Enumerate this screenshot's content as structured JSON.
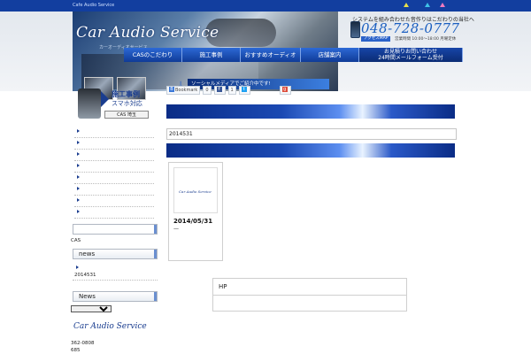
{
  "topbar": {
    "text": "Cafe Audio Service",
    "triangles": [
      "#e8e04a",
      "#3fc2e8",
      "#f07ac0"
    ]
  },
  "header": {
    "logo": "Car Audio Service",
    "logo_sub": "カーオーディオサービス",
    "tagline": "システムを組み合わせた音作りはこだわりの当社へ",
    "tel": "048-728-0777",
    "access": "アクセスMAP",
    "hours": "営業時間 10:00～18:00 月曜定休",
    "sns_banner": "ソーシャルメディアでご紹介中です!"
  },
  "nav": [
    {
      "label": "CASのこだわり"
    },
    {
      "label": "施工事例"
    },
    {
      "label": "おすすめオーディオ"
    },
    {
      "label": "店舗案内"
    },
    {
      "label": "お見積りお問い合わせ",
      "sub": "24時間メールフォーム受付"
    }
  ],
  "promo": {
    "title": "施工事例",
    "subtitle": "スマホ対応",
    "button": "CAS 埼玉"
  },
  "share": {
    "bookmark": "Bookmark",
    "count1": "0",
    "count2": "1"
  },
  "main": {
    "breadcrumb": "2014531",
    "post_date": "2014/05/31",
    "post_excerpt": "—",
    "thumb_brand": "Car Audio Service",
    "hp_label": "HP"
  },
  "sidebar": {
    "link_count": 8,
    "cas_label": "CAS",
    "news_title": "news",
    "news_item": "2014531",
    "news2_title": "News",
    "archive_placeholder": "",
    "logo": "Car Audio Service",
    "zip": "362-0808",
    "addr": "685"
  }
}
